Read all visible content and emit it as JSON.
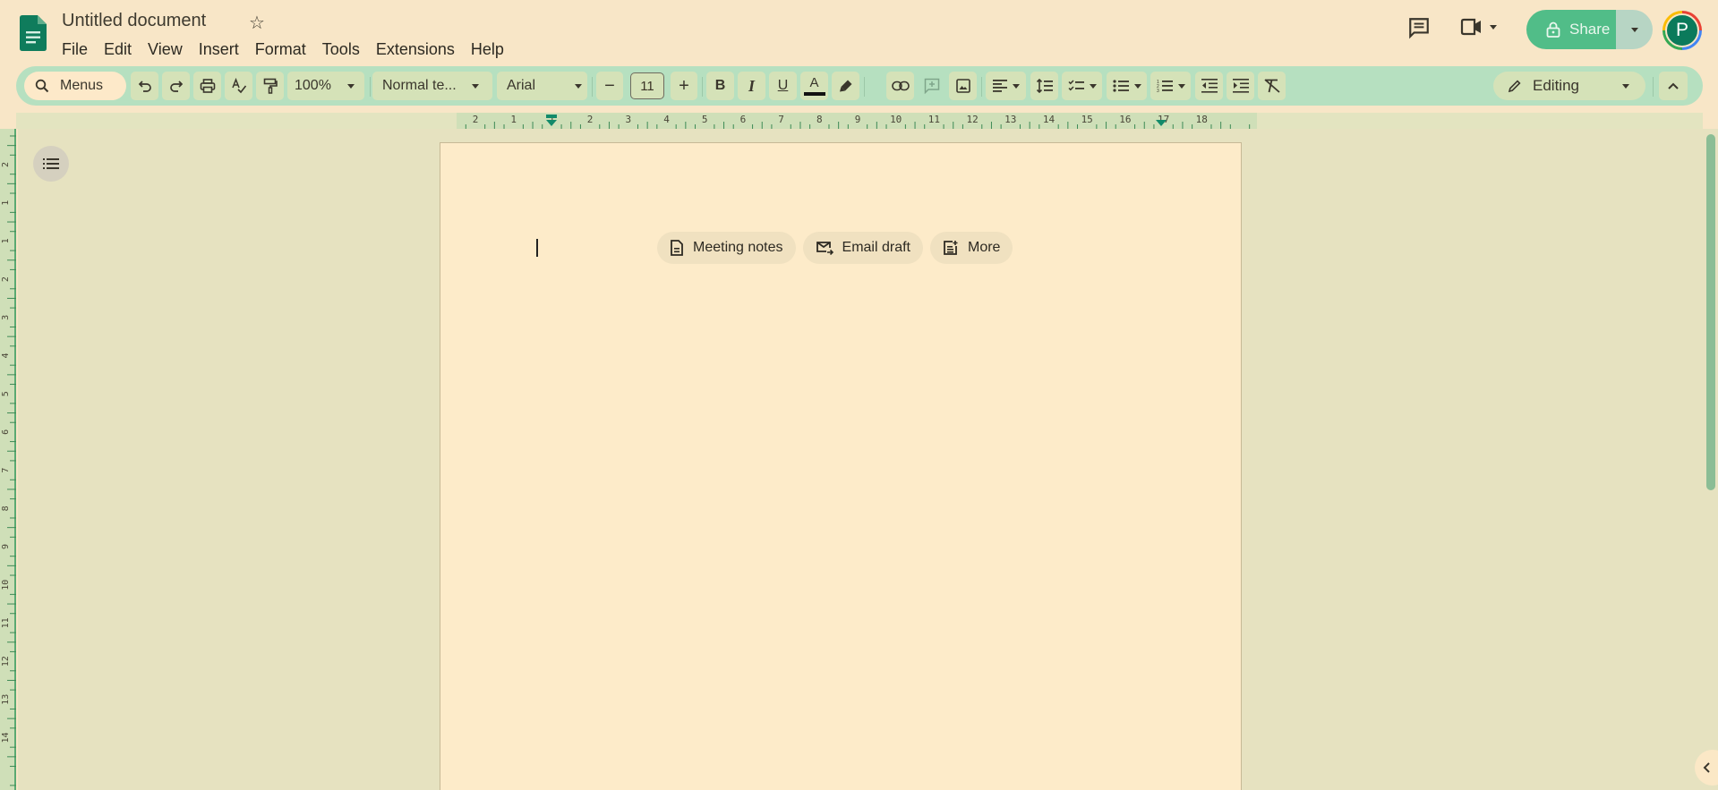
{
  "header": {
    "app_icon": "google-docs-icon",
    "title": "Untitled document",
    "star_icon": "star-outline-icon",
    "menus": [
      "File",
      "Edit",
      "View",
      "Insert",
      "Format",
      "Tools",
      "Extensions",
      "Help"
    ],
    "comments_icon": "comments-icon",
    "meet_icon": "video-camera-icon",
    "share_label": "Share",
    "share_icon": "lock-icon",
    "avatar_initial": "P",
    "colors": {
      "share": "#51bd88",
      "avatar": "#0b7a5b",
      "logo": "#0f7c5c"
    }
  },
  "toolbar": {
    "search_label": "Menus",
    "zoom": "100%",
    "style": "Normal te...",
    "font": "Arial",
    "font_size": "11",
    "decrease_label": "−",
    "increase_label": "+",
    "bold_label": "B",
    "italic_label": "I",
    "underline_label": "U",
    "text_color_label": "A",
    "mode": "Editing",
    "colors": {
      "toolbar_bg": "#b6e0c0",
      "button_bg": "#d5e2b8"
    }
  },
  "ruler": {
    "horizontal_ticks": [
      "2",
      "1",
      "1",
      "2",
      "3",
      "4",
      "5",
      "6",
      "7",
      "8",
      "9",
      "10",
      "11",
      "12",
      "13",
      "14",
      "15",
      "16",
      "17",
      "18"
    ],
    "vertical_ticks": [
      "2",
      "1",
      "1",
      "2",
      "3",
      "4",
      "5",
      "6",
      "7",
      "8",
      "9",
      "10",
      "11",
      "12",
      "13",
      "14"
    ]
  },
  "document": {
    "chips": [
      {
        "label": "Meeting notes",
        "icon": "document-icon"
      },
      {
        "label": "Email draft",
        "icon": "email-send-icon"
      },
      {
        "label": "More",
        "icon": "note-add-icon"
      }
    ],
    "outline_icon": "outline-list-icon",
    "side_panel_icon": "chevron-left-icon"
  }
}
